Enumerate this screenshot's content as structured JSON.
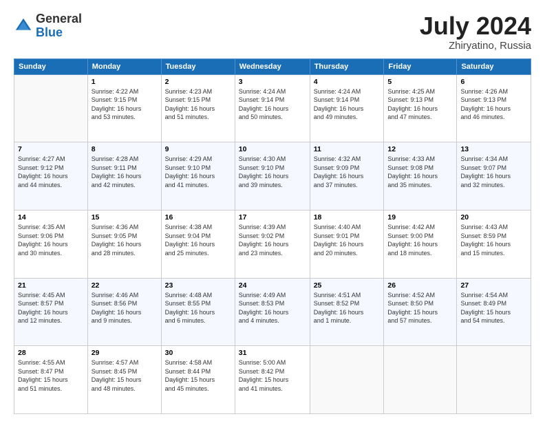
{
  "header": {
    "logo_general": "General",
    "logo_blue": "Blue",
    "month_title": "July 2024",
    "location": "Zhiryatino, Russia"
  },
  "days_of_week": [
    "Sunday",
    "Monday",
    "Tuesday",
    "Wednesday",
    "Thursday",
    "Friday",
    "Saturday"
  ],
  "weeks": [
    [
      {
        "day": "",
        "info": ""
      },
      {
        "day": "1",
        "info": "Sunrise: 4:22 AM\nSunset: 9:15 PM\nDaylight: 16 hours\nand 53 minutes."
      },
      {
        "day": "2",
        "info": "Sunrise: 4:23 AM\nSunset: 9:15 PM\nDaylight: 16 hours\nand 51 minutes."
      },
      {
        "day": "3",
        "info": "Sunrise: 4:24 AM\nSunset: 9:14 PM\nDaylight: 16 hours\nand 50 minutes."
      },
      {
        "day": "4",
        "info": "Sunrise: 4:24 AM\nSunset: 9:14 PM\nDaylight: 16 hours\nand 49 minutes."
      },
      {
        "day": "5",
        "info": "Sunrise: 4:25 AM\nSunset: 9:13 PM\nDaylight: 16 hours\nand 47 minutes."
      },
      {
        "day": "6",
        "info": "Sunrise: 4:26 AM\nSunset: 9:13 PM\nDaylight: 16 hours\nand 46 minutes."
      }
    ],
    [
      {
        "day": "7",
        "info": "Sunrise: 4:27 AM\nSunset: 9:12 PM\nDaylight: 16 hours\nand 44 minutes."
      },
      {
        "day": "8",
        "info": "Sunrise: 4:28 AM\nSunset: 9:11 PM\nDaylight: 16 hours\nand 42 minutes."
      },
      {
        "day": "9",
        "info": "Sunrise: 4:29 AM\nSunset: 9:10 PM\nDaylight: 16 hours\nand 41 minutes."
      },
      {
        "day": "10",
        "info": "Sunrise: 4:30 AM\nSunset: 9:10 PM\nDaylight: 16 hours\nand 39 minutes."
      },
      {
        "day": "11",
        "info": "Sunrise: 4:32 AM\nSunset: 9:09 PM\nDaylight: 16 hours\nand 37 minutes."
      },
      {
        "day": "12",
        "info": "Sunrise: 4:33 AM\nSunset: 9:08 PM\nDaylight: 16 hours\nand 35 minutes."
      },
      {
        "day": "13",
        "info": "Sunrise: 4:34 AM\nSunset: 9:07 PM\nDaylight: 16 hours\nand 32 minutes."
      }
    ],
    [
      {
        "day": "14",
        "info": "Sunrise: 4:35 AM\nSunset: 9:06 PM\nDaylight: 16 hours\nand 30 minutes."
      },
      {
        "day": "15",
        "info": "Sunrise: 4:36 AM\nSunset: 9:05 PM\nDaylight: 16 hours\nand 28 minutes."
      },
      {
        "day": "16",
        "info": "Sunrise: 4:38 AM\nSunset: 9:04 PM\nDaylight: 16 hours\nand 25 minutes."
      },
      {
        "day": "17",
        "info": "Sunrise: 4:39 AM\nSunset: 9:02 PM\nDaylight: 16 hours\nand 23 minutes."
      },
      {
        "day": "18",
        "info": "Sunrise: 4:40 AM\nSunset: 9:01 PM\nDaylight: 16 hours\nand 20 minutes."
      },
      {
        "day": "19",
        "info": "Sunrise: 4:42 AM\nSunset: 9:00 PM\nDaylight: 16 hours\nand 18 minutes."
      },
      {
        "day": "20",
        "info": "Sunrise: 4:43 AM\nSunset: 8:59 PM\nDaylight: 16 hours\nand 15 minutes."
      }
    ],
    [
      {
        "day": "21",
        "info": "Sunrise: 4:45 AM\nSunset: 8:57 PM\nDaylight: 16 hours\nand 12 minutes."
      },
      {
        "day": "22",
        "info": "Sunrise: 4:46 AM\nSunset: 8:56 PM\nDaylight: 16 hours\nand 9 minutes."
      },
      {
        "day": "23",
        "info": "Sunrise: 4:48 AM\nSunset: 8:55 PM\nDaylight: 16 hours\nand 6 minutes."
      },
      {
        "day": "24",
        "info": "Sunrise: 4:49 AM\nSunset: 8:53 PM\nDaylight: 16 hours\nand 4 minutes."
      },
      {
        "day": "25",
        "info": "Sunrise: 4:51 AM\nSunset: 8:52 PM\nDaylight: 16 hours\nand 1 minute."
      },
      {
        "day": "26",
        "info": "Sunrise: 4:52 AM\nSunset: 8:50 PM\nDaylight: 15 hours\nand 57 minutes."
      },
      {
        "day": "27",
        "info": "Sunrise: 4:54 AM\nSunset: 8:49 PM\nDaylight: 15 hours\nand 54 minutes."
      }
    ],
    [
      {
        "day": "28",
        "info": "Sunrise: 4:55 AM\nSunset: 8:47 PM\nDaylight: 15 hours\nand 51 minutes."
      },
      {
        "day": "29",
        "info": "Sunrise: 4:57 AM\nSunset: 8:45 PM\nDaylight: 15 hours\nand 48 minutes."
      },
      {
        "day": "30",
        "info": "Sunrise: 4:58 AM\nSunset: 8:44 PM\nDaylight: 15 hours\nand 45 minutes."
      },
      {
        "day": "31",
        "info": "Sunrise: 5:00 AM\nSunset: 8:42 PM\nDaylight: 15 hours\nand 41 minutes."
      },
      {
        "day": "",
        "info": ""
      },
      {
        "day": "",
        "info": ""
      },
      {
        "day": "",
        "info": ""
      }
    ]
  ]
}
